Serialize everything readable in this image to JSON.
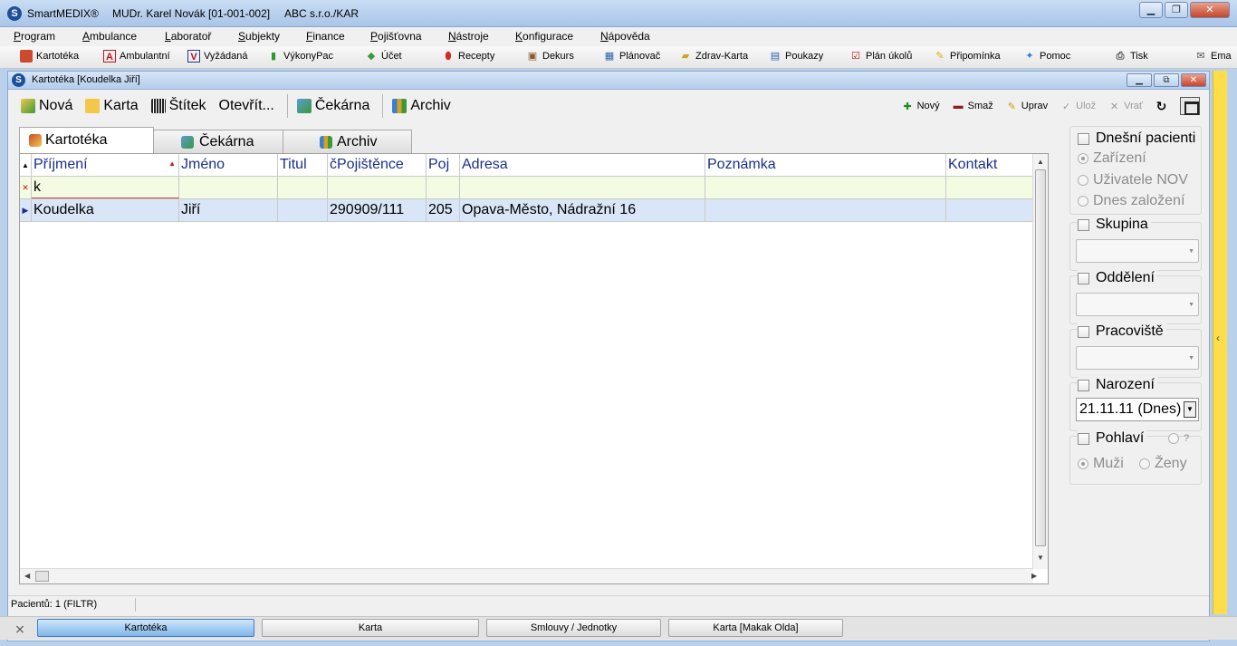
{
  "window": {
    "app_name": "SmartMEDIX®",
    "doctor": "MUDr. Karel Novák [01-001-002]",
    "company": "ABC s.r.o./KAR",
    "buttons": [
      "▁",
      "❐",
      "✕"
    ]
  },
  "menu": [
    "Program",
    "Ambulance",
    "Laboratoř",
    "Subjekty",
    "Finance",
    "Pojišťovna",
    "Nástroje",
    "Konfigurace",
    "Nápověda"
  ],
  "quickbar": [
    {
      "label": "Kartotéka",
      "icon": "cards-icon"
    },
    {
      "label": "Ambulantní",
      "icon": "ambulance-a-icon"
    },
    {
      "label": "Vyžádaná",
      "icon": "requested-v-icon"
    },
    {
      "label": "VýkonyPac",
      "icon": "bar-chart-icon"
    },
    {
      "label": "Účet",
      "icon": "money-icon"
    },
    {
      "label": "Recepty",
      "icon": "pill-icon"
    },
    {
      "label": "Dekurs",
      "icon": "briefcase-icon"
    },
    {
      "label": "Plánovač",
      "icon": "calendar-icon"
    },
    {
      "label": "Zdrav-Karta",
      "icon": "folder-icon"
    },
    {
      "label": "Poukazy",
      "icon": "document-icon"
    },
    {
      "label": "Plán úkolů",
      "icon": "checklist-icon"
    },
    {
      "label": "Připomínka",
      "icon": "pin-icon"
    },
    {
      "label": "Pomoc",
      "icon": "help-icon"
    },
    {
      "label": "Tisk",
      "icon": "printer-icon"
    },
    {
      "label": "Ema",
      "icon": "email-icon"
    }
  ],
  "child": {
    "title": "Kartotéka [Koudelka Jiří]",
    "buttons": [
      "▁",
      "⧉",
      "✕"
    ]
  },
  "toolbar": {
    "items": [
      {
        "label": "Nová",
        "icon": "new-card-icon"
      },
      {
        "label": "Karta",
        "icon": "card-folder-icon"
      },
      {
        "label": "Štítek",
        "icon": "barcode-icon"
      },
      {
        "label": "Otevřít...",
        "icon": ""
      }
    ],
    "items2": [
      {
        "label": "Čekárna",
        "icon": "waiting-room-icon"
      },
      {
        "label": "Archiv",
        "icon": "archive-icon"
      }
    ],
    "right": [
      {
        "label": "Nový",
        "icon": "plus-icon",
        "glyph": "✚",
        "color": "#1e8a1e",
        "enabled": true
      },
      {
        "label": "Smaž",
        "icon": "minus-icon",
        "glyph": "▬",
        "color": "#8b1e1e",
        "enabled": true
      },
      {
        "label": "Uprav",
        "icon": "pencil-icon",
        "glyph": "✎",
        "color": "#c8a000",
        "enabled": true
      },
      {
        "label": "Ulož",
        "icon": "check-icon",
        "glyph": "✓",
        "color": "#9a9a9a",
        "enabled": false
      },
      {
        "label": "Vrať",
        "icon": "cross-icon",
        "glyph": "✕",
        "color": "#9a9a9a",
        "enabled": false
      }
    ],
    "refresh_glyph": "↻"
  },
  "tabs": [
    {
      "label": "Kartotéka",
      "active": true
    },
    {
      "label": "Čekárna",
      "active": false
    },
    {
      "label": "Archiv",
      "active": false
    }
  ],
  "grid": {
    "columns": [
      "Příjmení",
      "Jméno",
      "Titul",
      "čPojištěnce",
      "Poj",
      "Adresa",
      "Poznámka",
      "Kontakt"
    ],
    "filter": [
      "k",
      "",
      "",
      "",
      "",
      "",
      "",
      ""
    ],
    "rows": [
      [
        "Koudelka",
        "Jiří",
        "",
        "290909/111",
        "205",
        "Opava-Město, Nádražní 16",
        "",
        ""
      ]
    ],
    "sort_glyph": "▲",
    "filter_clear_glyph": "✕",
    "row_glyph": "▶"
  },
  "side": {
    "dnesni": "Dnešní pacienti",
    "dnesni_opts": [
      "Zařízení",
      "Uživatele NOV",
      "Dnes založení"
    ],
    "skupina": "Skupina",
    "oddeleni": "Oddělení",
    "pracoviste": "Pracoviště",
    "narozeni": "Narození",
    "narozeni_value": "21.11.11 (Dnes)",
    "pohlavi": "Pohlaví",
    "pohlavi_unknown": "?",
    "muzi": "Muži",
    "zeny": "Ženy"
  },
  "status": {
    "text": "Pacientů: 1  (FILTR)"
  },
  "collapse_glyph": "‹",
  "taskbar": {
    "close_glyph": "⨯",
    "items": [
      {
        "label": "Kartotéka",
        "active": true
      },
      {
        "label": "Karta",
        "active": false
      },
      {
        "label": "Smlouvy / Jednotky",
        "active": false
      },
      {
        "label": "Karta [Makak Olda]",
        "active": false
      }
    ]
  },
  "colors": {
    "accent": "#1a2f8a",
    "selected_row": "#d8e6f7",
    "filter_row": "#f4fbe3",
    "collapse_bar": "#fdde4a"
  }
}
